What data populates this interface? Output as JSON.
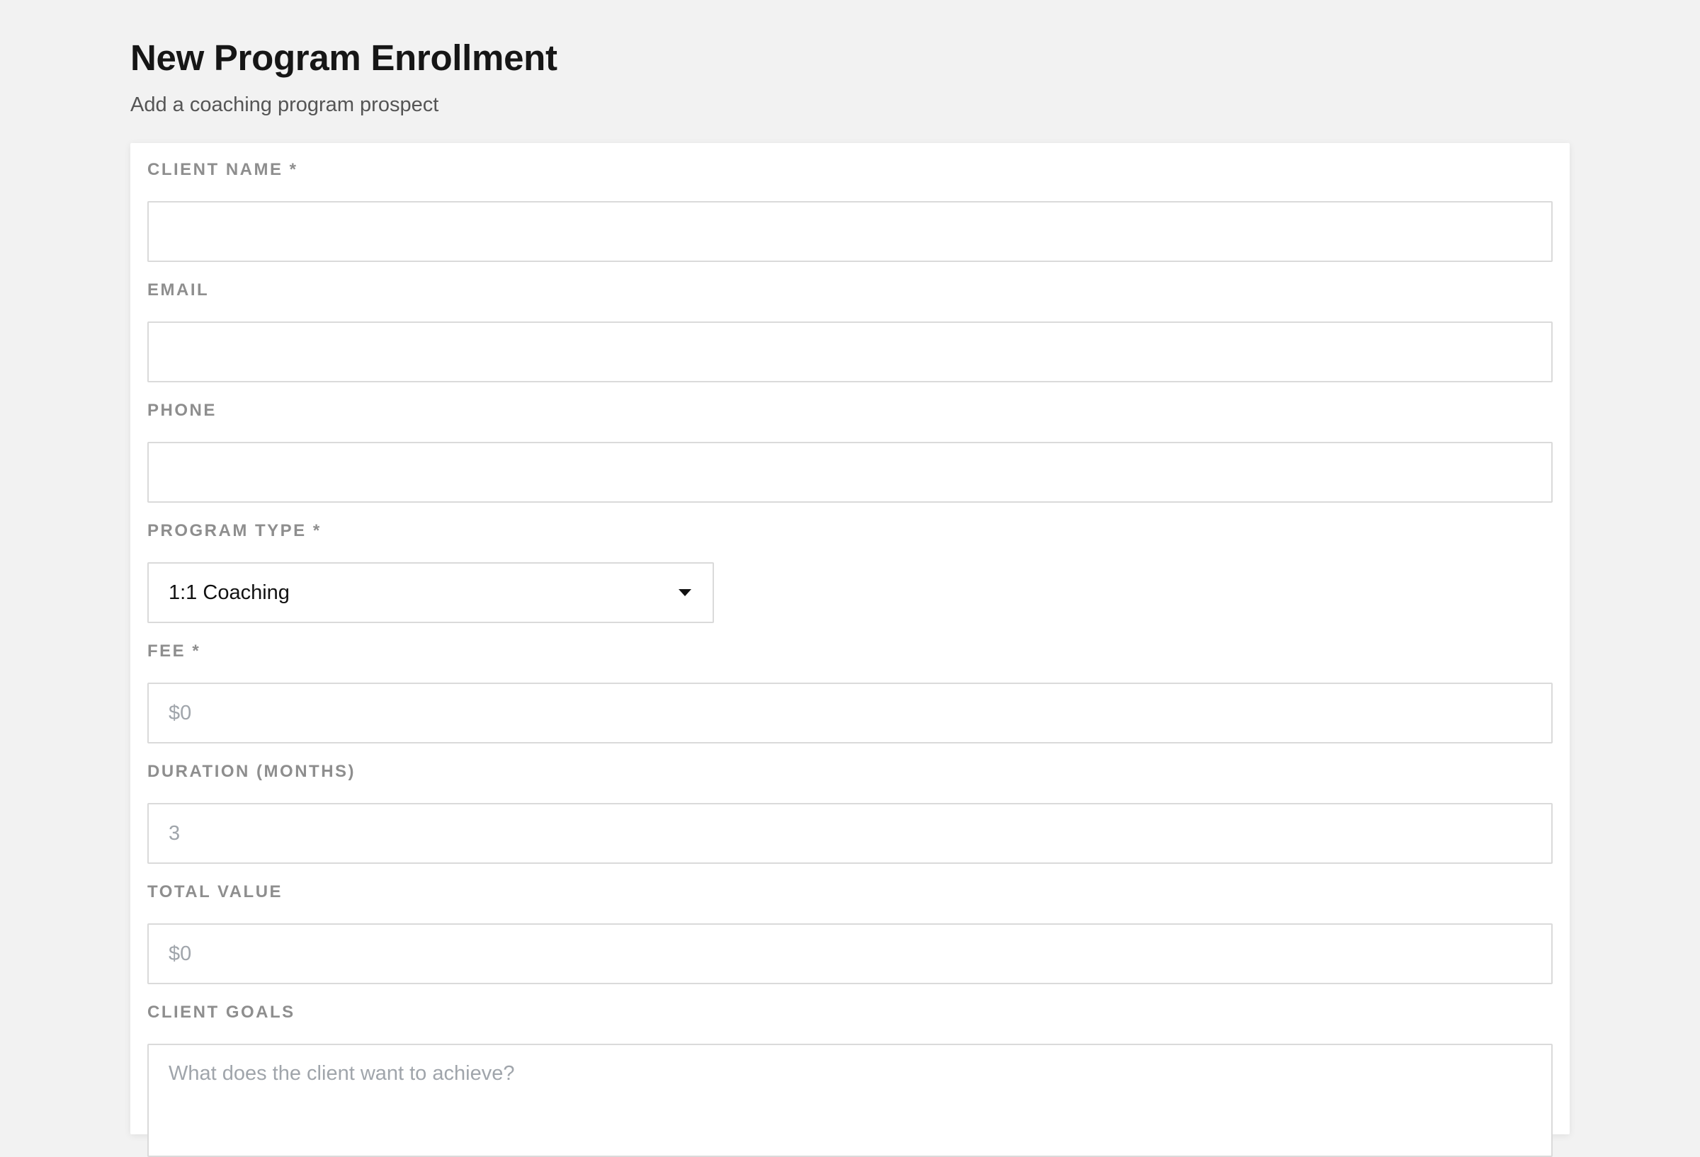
{
  "header": {
    "title": "New Program Enrollment",
    "subtitle": "Add a coaching program prospect"
  },
  "form": {
    "client_name": {
      "label": "CLIENT NAME *",
      "value": "",
      "placeholder": ""
    },
    "email": {
      "label": "EMAIL",
      "value": "",
      "placeholder": ""
    },
    "phone": {
      "label": "PHONE",
      "value": "",
      "placeholder": ""
    },
    "program_type": {
      "label": "PROGRAM TYPE *",
      "selected": "1:1 Coaching"
    },
    "fee": {
      "label": "FEE *",
      "placeholder": "$0"
    },
    "duration": {
      "label": "DURATION (MONTHS)",
      "placeholder": "3"
    },
    "total_value": {
      "label": "TOTAL VALUE",
      "placeholder": "$0"
    },
    "client_goals": {
      "label": "CLIENT GOALS",
      "placeholder": "What does the client want to achieve?"
    }
  },
  "icons": {
    "select_caret": "chevron-down-icon"
  }
}
